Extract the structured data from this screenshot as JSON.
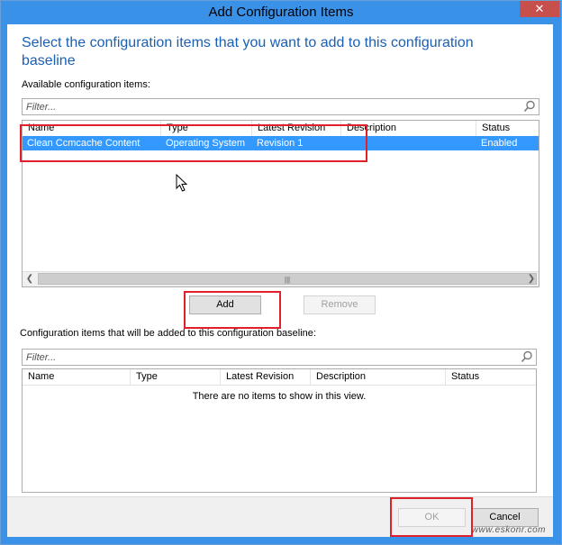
{
  "window": {
    "title": "Add Configuration Items",
    "close_glyph": "✕"
  },
  "heading": "Select the configuration items that you want to add to this configuration baseline",
  "available": {
    "label": "Available configuration items:",
    "filter_placeholder": "Filter...",
    "columns": [
      "Name",
      "Type",
      "Latest Revision",
      "Description",
      "Status"
    ],
    "rows": [
      {
        "name": "Clean Ccmcache Content",
        "type": "Operating System",
        "latest_revision": "Revision 1",
        "description": "",
        "status": "Enabled"
      }
    ]
  },
  "actions": {
    "add": "Add",
    "remove": "Remove"
  },
  "selected": {
    "label": "Configuration items that will be added to this configuration baseline:",
    "filter_placeholder": "Filter...",
    "columns": [
      "Name",
      "Type",
      "Latest Revision",
      "Description",
      "Status"
    ],
    "empty_text": "There are no items to show in this view."
  },
  "footer": {
    "ok": "OK",
    "cancel": "Cancel"
  },
  "watermark": "www.eskonr.com",
  "colors": {
    "title_bar": "#3a91e8",
    "heading": "#1a5fb4",
    "selection": "#3399ff",
    "annotation": "#e0202a"
  },
  "icons": [
    "search-icon",
    "close-icon",
    "chevron-left-icon",
    "chevron-right-icon",
    "mouse-cursor-icon"
  ]
}
